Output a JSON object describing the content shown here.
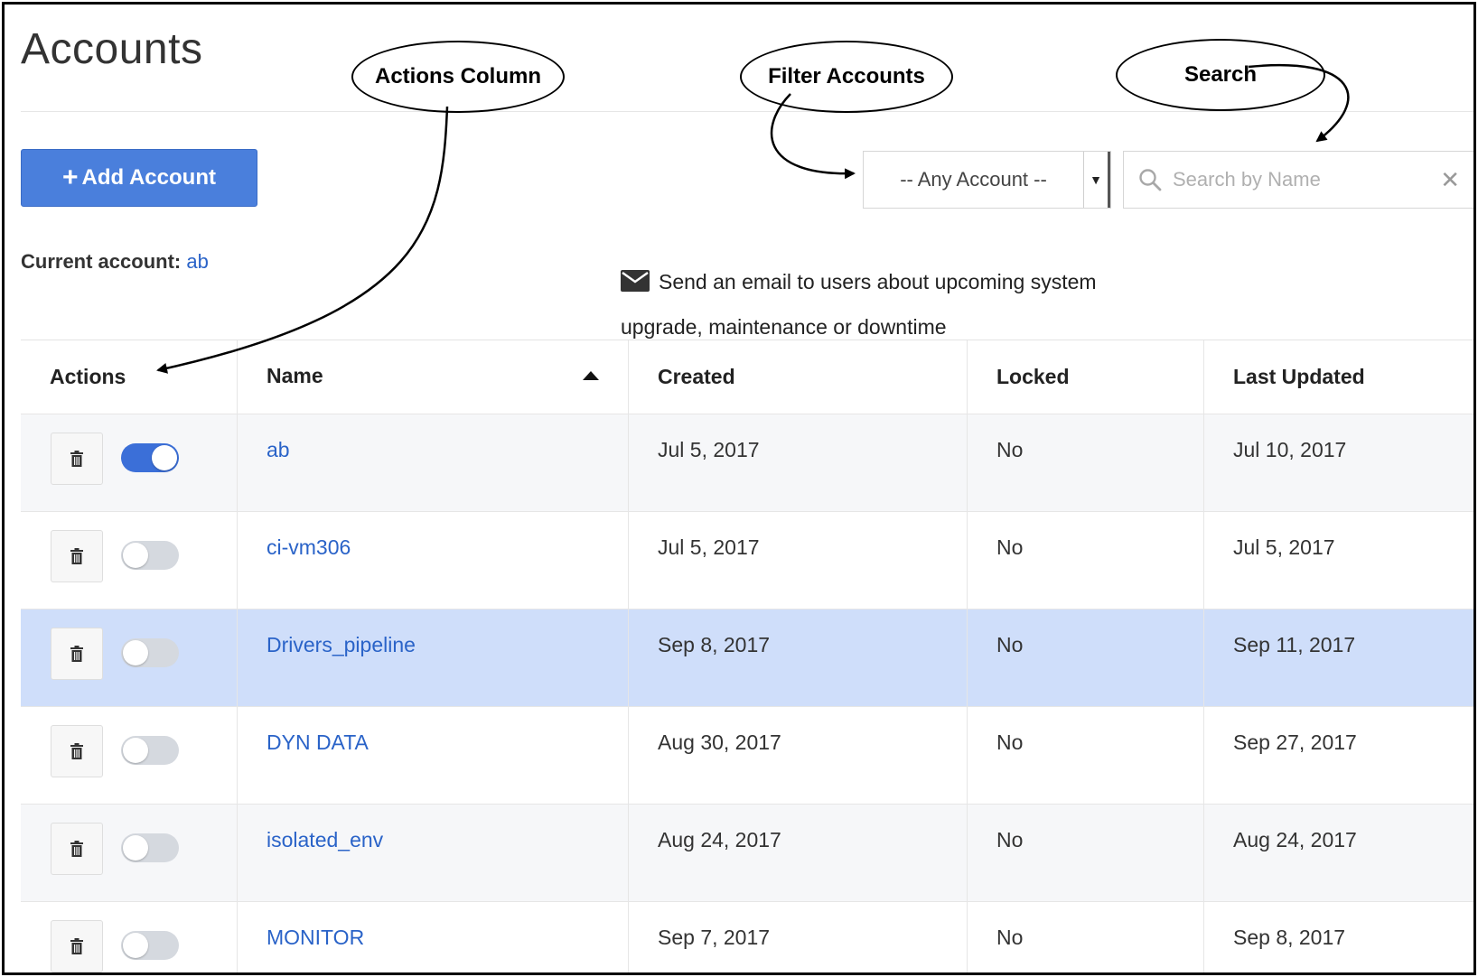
{
  "page": {
    "title": "Accounts"
  },
  "toolbar": {
    "add_button_label": "Add Account",
    "add_button_icon": "plus-icon",
    "current_account_label": "Current account:",
    "current_account_value": "ab"
  },
  "filter": {
    "selected": "-- Any Account --",
    "icon": "caret-down-icon"
  },
  "search": {
    "placeholder": "Search by Name",
    "value": "",
    "icon": "search-icon",
    "clear_icon": "close-icon"
  },
  "notice": {
    "icon": "envelope-icon",
    "text": "Send an email to users about upcoming system upgrade, maintenance or downtime"
  },
  "callouts": {
    "actions": "Actions Column",
    "filter": "Filter Accounts",
    "search": "Search"
  },
  "table": {
    "columns": [
      "Actions",
      "Name",
      "Created",
      "Locked",
      "Last Updated"
    ],
    "sort": {
      "column": "Name",
      "direction": "ascending"
    },
    "rows": [
      {
        "name": "ab",
        "created": "Jul 5, 2017",
        "locked": "No",
        "updated": "Jul 10, 2017",
        "enabled": true,
        "state": "striped"
      },
      {
        "name": "ci-vm306",
        "created": "Jul 5, 2017",
        "locked": "No",
        "updated": "Jul 5, 2017",
        "enabled": false,
        "state": "normal"
      },
      {
        "name": "Drivers_pipeline",
        "created": "Sep 8, 2017",
        "locked": "No",
        "updated": "Sep 11, 2017",
        "enabled": false,
        "state": "selected"
      },
      {
        "name": "DYN DATA",
        "created": "Aug 30, 2017",
        "locked": "No",
        "updated": "Sep 27, 2017",
        "enabled": false,
        "state": "normal"
      },
      {
        "name": "isolated_env",
        "created": "Aug 24, 2017",
        "locked": "No",
        "updated": "Aug 24, 2017",
        "enabled": false,
        "state": "striped"
      },
      {
        "name": "MONITOR",
        "created": "Sep 7, 2017",
        "locked": "No",
        "updated": "Sep 8, 2017",
        "enabled": false,
        "state": "normal"
      }
    ]
  },
  "colors": {
    "primary": "#4a7fdc",
    "link": "#2a63c8",
    "selected_row": "#cfdefa",
    "striped_row": "#f6f7f9",
    "toggle_on": "#3b6fd8",
    "toggle_off": "#d5d9df"
  }
}
